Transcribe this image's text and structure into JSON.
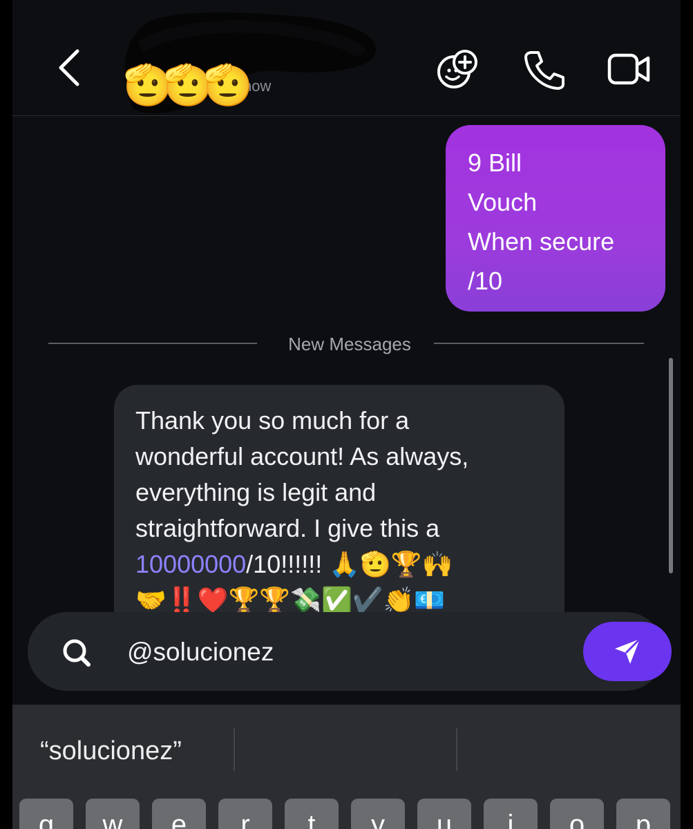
{
  "header": {
    "contact_emojis": "🫡🫡🫡",
    "presence_text": "Active now",
    "icons": [
      "back-chevron-icon",
      "effects-sticker-icon",
      "phone-icon",
      "video-camera-icon"
    ]
  },
  "messages": {
    "outgoing": {
      "lines": [
        "9 Bill",
        "Vouch",
        "When secure",
        "/10"
      ],
      "color": "#a333e0"
    },
    "divider_label": "New Messages",
    "incoming": {
      "line1": "Thank you so much for a",
      "line2": "wonderful account! As always,",
      "line3": "everything is legit and",
      "line4": "straightforward. I give this a",
      "rating_number": "10000000",
      "rating_suffix": "/10!!!!!!",
      "emojis_line5": "🙏🫡🏆🙌",
      "emojis_line6": "🤝‼️❤️🏆🏆💸✅✔️👏💶",
      "link_color": "#8d84ff"
    }
  },
  "composer": {
    "query": "@solucionez",
    "send_color": "#6b35f0"
  },
  "keyboard": {
    "suggestion": "“solucionez”",
    "keys": [
      "q",
      "w",
      "e",
      "r",
      "t",
      "y",
      "u",
      "i",
      "o",
      "p"
    ]
  }
}
